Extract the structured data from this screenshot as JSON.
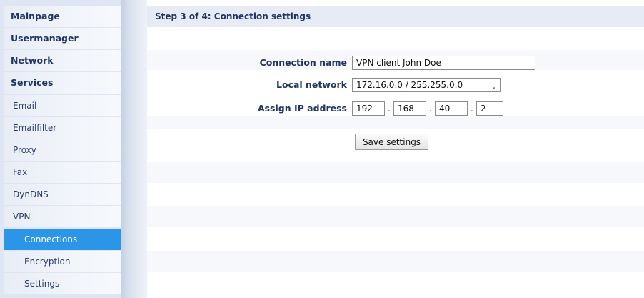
{
  "sidebar": {
    "items": [
      {
        "label": "Mainpage"
      },
      {
        "label": "Usermanager"
      },
      {
        "label": "Network"
      },
      {
        "label": "Services"
      },
      {
        "label": "Email"
      },
      {
        "label": "Emailfilter"
      },
      {
        "label": "Proxy"
      },
      {
        "label": "Fax"
      },
      {
        "label": "DynDNS"
      },
      {
        "label": "VPN"
      },
      {
        "label": "Connections"
      },
      {
        "label": "Encryption"
      },
      {
        "label": "Settings"
      }
    ],
    "active_item": "Connections",
    "active_color": "#2b96e7"
  },
  "main": {
    "title": "Step 3 of 4: Connection settings",
    "form": {
      "connection_name_label": "Connection name",
      "connection_name_value": "VPN client John Doe",
      "local_network_label": "Local network",
      "local_network_value": "172.16.0.0 / 255.255.0.0",
      "assign_ip_label": "Assign IP address",
      "ip_octets": [
        "192",
        "168",
        "40",
        "2"
      ],
      "ip_separator": "."
    },
    "save_button_label": "Save settings"
  }
}
